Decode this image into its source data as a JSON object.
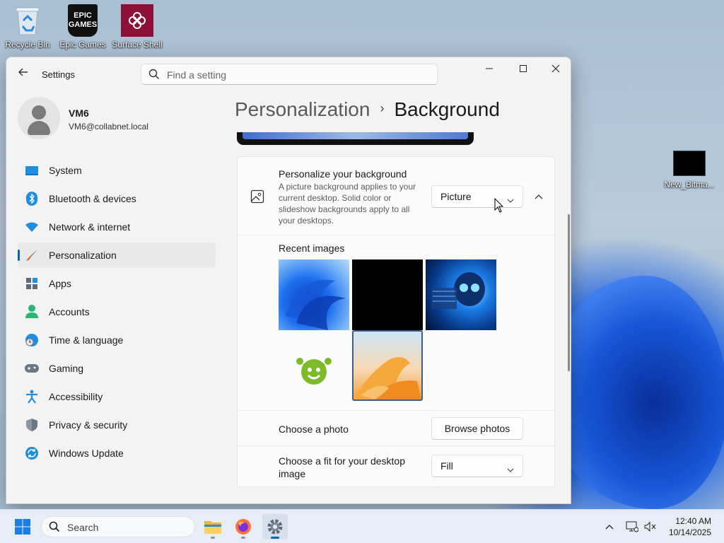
{
  "desktop": {
    "icons": [
      {
        "label": "Recycle Bin"
      },
      {
        "label": "Epic Games Launcher",
        "badge": "EPIC GAMES"
      },
      {
        "label": "Surface Shell"
      },
      {
        "label": "New_Bitma..."
      }
    ]
  },
  "window": {
    "title": "Settings",
    "search_placeholder": "Find a setting",
    "minimize_icon": "minimize-icon",
    "maximize_icon": "maximize-icon",
    "close_icon": "close-icon"
  },
  "profile": {
    "name": "VM6",
    "email": "VM6@collabnet.local"
  },
  "sidebar": {
    "items": [
      {
        "label": "System",
        "icon": "system-icon"
      },
      {
        "label": "Bluetooth & devices",
        "icon": "bluetooth-icon"
      },
      {
        "label": "Network & internet",
        "icon": "network-icon"
      },
      {
        "label": "Personalization",
        "icon": "brush-icon",
        "active": true
      },
      {
        "label": "Apps",
        "icon": "apps-icon"
      },
      {
        "label": "Accounts",
        "icon": "accounts-icon"
      },
      {
        "label": "Time & language",
        "icon": "time-language-icon"
      },
      {
        "label": "Gaming",
        "icon": "gaming-icon"
      },
      {
        "label": "Accessibility",
        "icon": "accessibility-icon"
      },
      {
        "label": "Privacy & security",
        "icon": "shield-icon"
      },
      {
        "label": "Windows Update",
        "icon": "update-icon"
      }
    ]
  },
  "breadcrumb": {
    "parent": "Personalization",
    "separator": "›",
    "current": "Background"
  },
  "background_card": {
    "title": "Personalize your background",
    "description": "A picture background applies to your current desktop. Solid color or slideshow backgrounds apply to all your desktops.",
    "dropdown_value": "Picture"
  },
  "recent_images": {
    "label": "Recent images",
    "images": [
      "blue-bloom",
      "black",
      "blue-skull",
      "green-mascot",
      "orange-bloom"
    ],
    "selected_index": 4
  },
  "choose_photo": {
    "label": "Choose a photo",
    "button_label": "Browse photos"
  },
  "choose_fit": {
    "label": "Choose a fit for your desktop image",
    "dropdown_value": "Fill"
  },
  "taskbar": {
    "search_label": "Search",
    "apps": [
      "file-explorer-icon",
      "firefox-icon",
      "settings-icon"
    ],
    "active_app": "settings-icon",
    "time": "12:40 AM",
    "date": "10/14/2025"
  },
  "colors": {
    "accent": "#0067c0",
    "window_bg": "#f3f3f3",
    "card_bg": "#fbfbfb"
  }
}
